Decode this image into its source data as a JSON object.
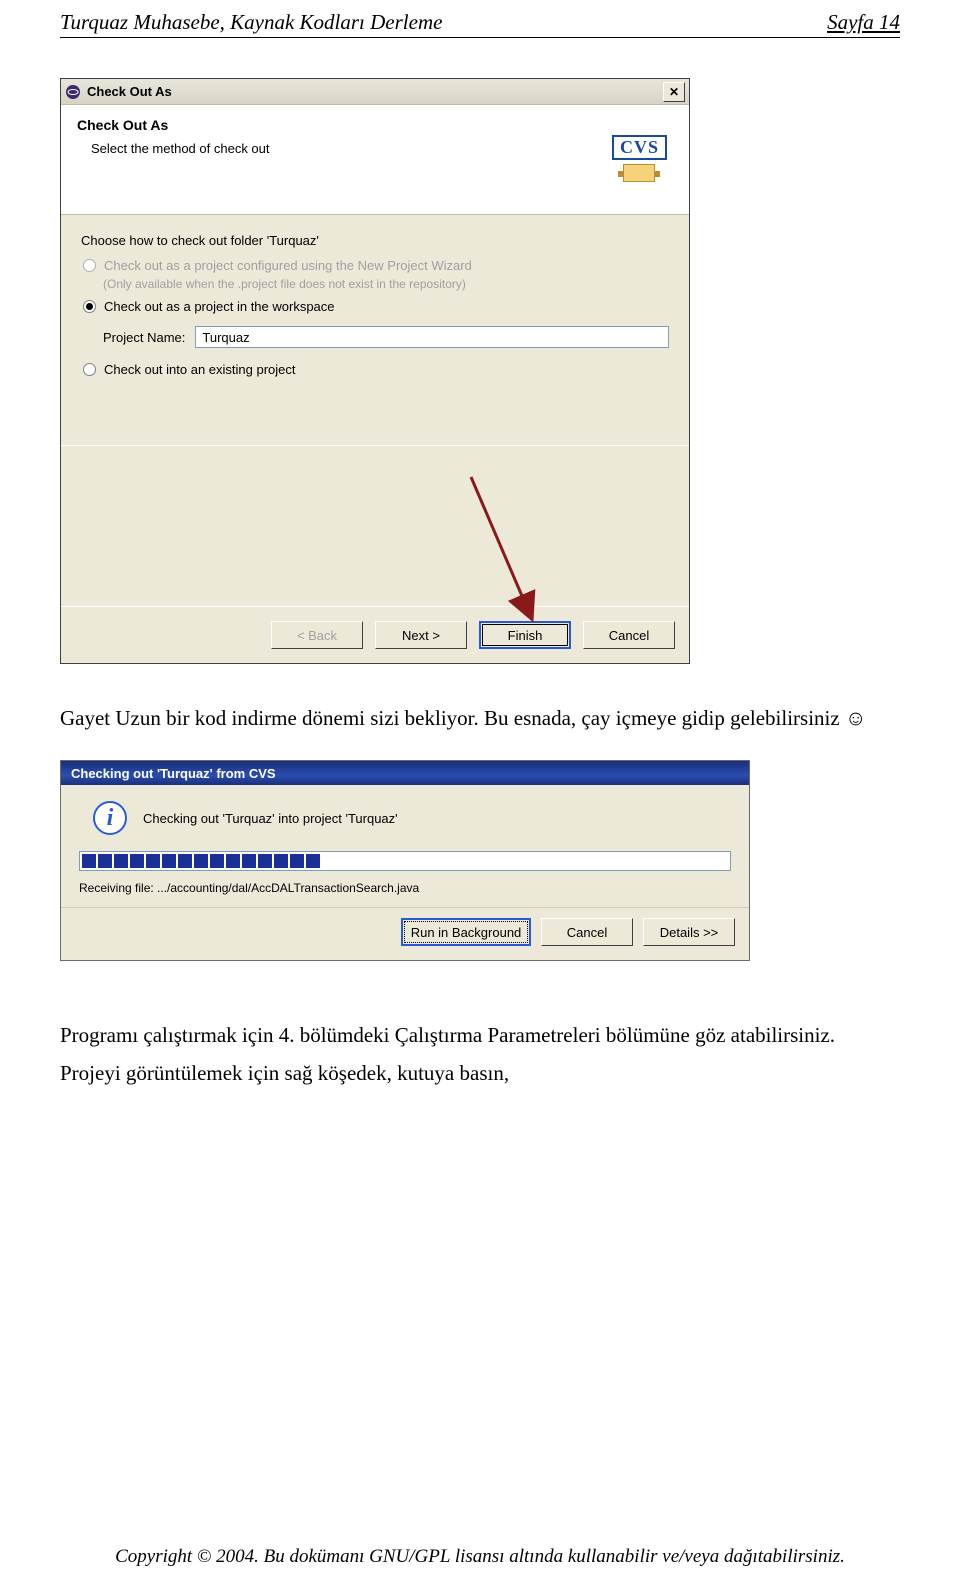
{
  "doc": {
    "header_left": "Turquaz Muhasebe, Kaynak Kodları Derleme",
    "header_right": "Sayfa 14",
    "footer": "Copyright © 2004. Bu dokümanı GNU/GPL lisansı altında kullanabilir ve/veya dağıtabilirsiniz."
  },
  "dialog1": {
    "title": "Check Out As",
    "banner_title": "Check Out As",
    "banner_sub": "Select the method of check out",
    "cvs_label": "CVS",
    "choose_label": "Choose how to check out folder 'Turquaz'",
    "opt1": "Check out as a project configured using the New Project Wizard",
    "opt1_note": "(Only available when the .project file does not exist in the repository)",
    "opt2": "Check out as a project in the workspace",
    "project_name_label": "Project Name:",
    "project_name_value": "Turquaz",
    "opt3": "Check out into an existing project",
    "buttons": {
      "back": "< Back",
      "next": "Next >",
      "finish": "Finish",
      "cancel": "Cancel"
    }
  },
  "para1": "Gayet Uzun bir kod indirme dönemi sizi bekliyor. Bu esnada, çay içmeye gidip gelebilirsiniz ☺",
  "dialog2": {
    "title": "Checking out 'Turquaz' from CVS",
    "message": "Checking out 'Turquaz' into project 'Turquaz'",
    "receiving": "Receiving file: .../accounting/dal/AccDALTransactionSearch.java",
    "segments": 15,
    "buttons": {
      "bg": "Run in Background",
      "cancel": "Cancel",
      "details": "Details >>"
    }
  },
  "para2": "Programı çalıştırmak için 4. bölümdeki Çalıştırma Parametreleri bölümüne göz atabilirsiniz.",
  "para3": "Projeyi görüntülemek için sağ köşedek, kutuya basın,"
}
